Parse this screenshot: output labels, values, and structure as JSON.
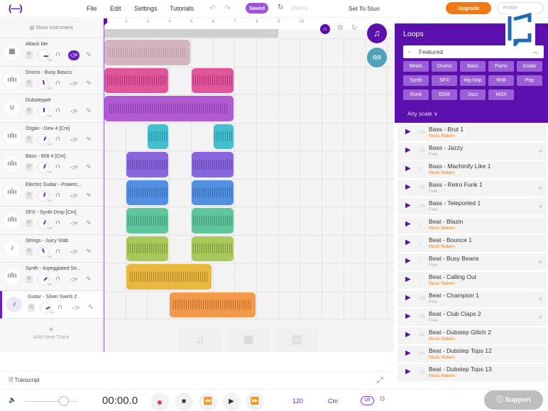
{
  "topbar": {
    "logo": "(—)",
    "menu": [
      "File",
      "Edit",
      "Settings",
      "Tutorials"
    ],
    "saved_label": "Saved",
    "mixing_label": "Mixing...",
    "project_title": "Set To Stun",
    "upgrade_label": "Upgrade",
    "profile_label": "Profile"
  },
  "tracks_header": {
    "show_instrument": "Show Instrument"
  },
  "tracks": [
    {
      "name": "Attack Me",
      "icon": "grid-instrument-icon",
      "glyph": "▦",
      "knob": 90,
      "muted": true,
      "selected": false
    },
    {
      "name": "Drums - Busy Basics",
      "icon": "waveform-icon",
      "glyph": "ıılıı",
      "knob": -10,
      "muted": false,
      "selected": false
    },
    {
      "name": "Dubstepper",
      "icon": "drum-icon",
      "glyph": "ʊ",
      "knob": 0,
      "muted": false,
      "selected": false
    },
    {
      "name": "Organ - Dew 4 [Cm]",
      "icon": "waveform-icon",
      "glyph": "ıılıı",
      "knob": 25,
      "muted": false,
      "selected": false
    },
    {
      "name": "Bass - 808 4 [Cm]",
      "icon": "waveform-icon",
      "glyph": "ıılıı",
      "knob": 20,
      "muted": false,
      "selected": false
    },
    {
      "name": "Electric Guitar - Powerc...",
      "icon": "waveform-icon",
      "glyph": "ıılıı",
      "knob": 15,
      "muted": false,
      "selected": false
    },
    {
      "name": "SFX - Synth Drop [Cm]",
      "icon": "waveform-icon",
      "glyph": "ıılıı",
      "knob": 20,
      "muted": false,
      "selected": false
    },
    {
      "name": "Strings - Juicy Stab",
      "icon": "strings-icon",
      "glyph": "♪",
      "knob": -20,
      "muted": false,
      "selected": false
    },
    {
      "name": "Synth - Arpeggiated Se...",
      "icon": "waveform-icon",
      "glyph": "ıılıı",
      "knob": 45,
      "muted": false,
      "selected": false
    },
    {
      "name": "Guitar - Silver Swirls 2",
      "icon": "guitar-icon",
      "glyph": "♪",
      "knob": 65,
      "muted": false,
      "selected": true
    }
  ],
  "track_controls": {
    "record": "R",
    "vol": "Vol"
  },
  "add_track_label": "Add New Track",
  "ruler": [
    "2",
    "3",
    "4",
    "5",
    "6",
    "7",
    "8",
    "9",
    "10"
  ],
  "loop_region": {
    "start_arrow": "→",
    "end_arrow": "←"
  },
  "clips": [
    {
      "track": 0,
      "start": 0,
      "end": 8,
      "color": "#d5b5bf",
      "wave": "#a58890"
    },
    {
      "track": 1,
      "start": 0,
      "end": 6,
      "color": "#e2559b",
      "wave": "#7a1f4d"
    },
    {
      "track": 1,
      "start": 8,
      "end": 12,
      "color": "#e2559b",
      "wave": "#7a1f4d"
    },
    {
      "track": 2,
      "start": 0,
      "end": 12,
      "color": "#b25ad4",
      "wave": "#5e2378"
    },
    {
      "track": 3,
      "start": 4,
      "end": 6,
      "color": "#43bfd2",
      "wave": "#1e6a75"
    },
    {
      "track": 3,
      "start": 10,
      "end": 12,
      "color": "#43bfd2",
      "wave": "#1e6a75"
    },
    {
      "track": 4,
      "start": 2,
      "end": 6,
      "color": "#8966de",
      "wave": "#3f2a80"
    },
    {
      "track": 4,
      "start": 8,
      "end": 12,
      "color": "#8966de",
      "wave": "#3f2a80"
    },
    {
      "track": 5,
      "start": 2,
      "end": 6,
      "color": "#528fe0",
      "wave": "#27508a"
    },
    {
      "track": 5,
      "start": 8,
      "end": 12,
      "color": "#528fe0",
      "wave": "#27508a"
    },
    {
      "track": 6,
      "start": 2,
      "end": 6,
      "color": "#5fc59c",
      "wave": "#2a6e55"
    },
    {
      "track": 6,
      "start": 8,
      "end": 12,
      "color": "#5fc59c",
      "wave": "#2a6e55"
    },
    {
      "track": 7,
      "start": 2,
      "end": 6,
      "color": "#a9c95a",
      "wave": "#55672a"
    },
    {
      "track": 7,
      "start": 8,
      "end": 12,
      "color": "#a9c95a",
      "wave": "#55672a"
    },
    {
      "track": 8,
      "start": 2,
      "end": 10,
      "color": "#e9b83f",
      "wave": "#7a5a14"
    },
    {
      "track": 9,
      "start": 6,
      "end": 14,
      "color": "#f4984a",
      "wave": "#8a4a15"
    }
  ],
  "loops_panel": {
    "title": "Loops",
    "search_value": "Featured",
    "chips": [
      "Beats",
      "Drums",
      "Bass",
      "Piano",
      "Guitar",
      "Synth",
      "SFX",
      "Hip Hop",
      "RnB",
      "Pop",
      "Rock",
      "EDM",
      "Jazz",
      "MIDI"
    ],
    "scale_label": "Any scale",
    "items": [
      {
        "name": "Bass - Brut 1",
        "source": "Music Makers",
        "free": false,
        "icon": "waveform-icon",
        "glyph": "ıılı",
        "heart": false
      },
      {
        "name": "Bass - Jazzy",
        "source": "Free",
        "free": true,
        "icon": "waveform-icon",
        "glyph": "ıılı",
        "heart": true
      },
      {
        "name": "Bass - Machinify Like 1",
        "source": "Music Makers",
        "free": false,
        "icon": "note-icon",
        "glyph": "♫",
        "heart": false
      },
      {
        "name": "Bass - Retro Funk 1",
        "source": "Free",
        "free": true,
        "icon": "waveform-icon",
        "glyph": "ıılı",
        "heart": true
      },
      {
        "name": "Bass - Teleported 1",
        "source": "Free",
        "free": true,
        "icon": "waveform-icon",
        "glyph": "ıılı",
        "heart": true
      },
      {
        "name": "Beat - Blazin",
        "source": "Music Makers",
        "free": false,
        "icon": "note-icon",
        "glyph": "♫",
        "heart": false
      },
      {
        "name": "Beat - Bounce 1",
        "source": "Music Makers",
        "free": false,
        "icon": "note-icon",
        "glyph": "♫",
        "heart": false
      },
      {
        "name": "Beat - Busy Beans",
        "source": "Free",
        "free": true,
        "icon": "note-icon",
        "glyph": "♫",
        "heart": true
      },
      {
        "name": "Beat - Calling Out",
        "source": "Music Makers",
        "free": false,
        "icon": "note-icon",
        "glyph": "♫",
        "heart": false
      },
      {
        "name": "Beat - Champion 1",
        "source": "Free",
        "free": true,
        "icon": "waveform-icon",
        "glyph": "ıılı",
        "heart": true
      },
      {
        "name": "Beat - Club Claps 2",
        "source": "Free",
        "free": true,
        "icon": "waveform-icon",
        "glyph": "ıılı",
        "heart": true
      },
      {
        "name": "Beat - Dubstep Glitch 2",
        "source": "Music Makers",
        "free": false,
        "icon": "waveform-icon",
        "glyph": "ıılı",
        "heart": false
      },
      {
        "name": "Beat - Dubstep Tops 12",
        "source": "Music Makers",
        "free": false,
        "icon": "waveform-icon",
        "glyph": "ıılı",
        "heart": false
      },
      {
        "name": "Beat - Dubstep Tops 13",
        "source": "Music Makers",
        "free": false,
        "icon": "waveform-icon",
        "glyph": "ıılı",
        "heart": false
      }
    ]
  },
  "transcript_label": "Transcript",
  "transport": {
    "time": "00:00.0",
    "volume": 0.75,
    "bpm": "120",
    "key": "Cm",
    "metronome": "Off"
  },
  "support_label": "Support",
  "colors": {
    "brand": "#5b0fad",
    "accent": "#f27a12",
    "saved": "#9a56d6"
  }
}
